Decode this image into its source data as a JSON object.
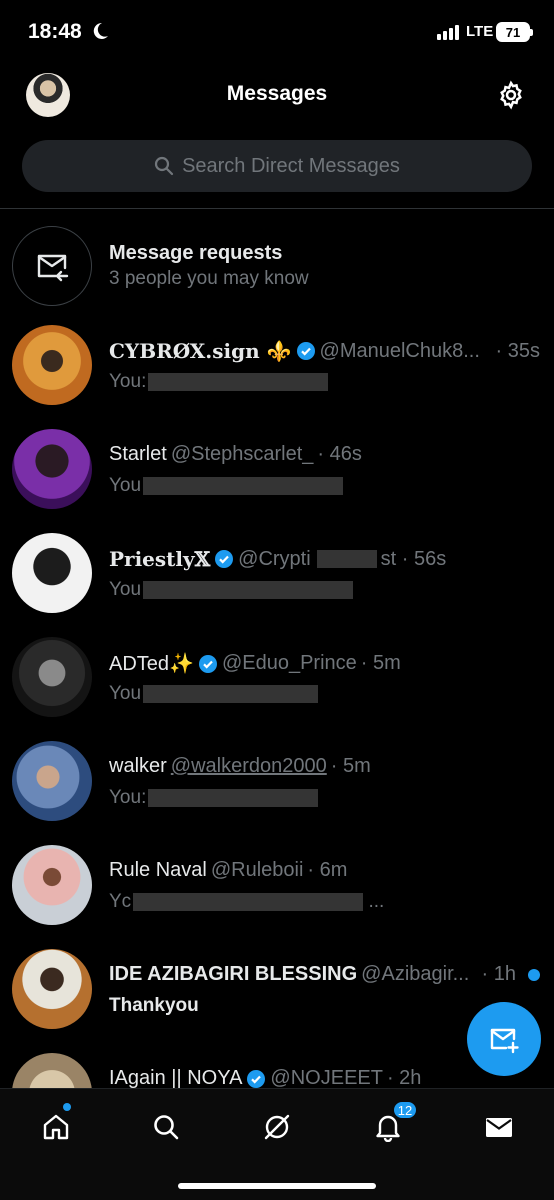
{
  "status_bar": {
    "time": "18:48",
    "network": "LTE",
    "battery": "71"
  },
  "header": {
    "title": "Messages"
  },
  "search": {
    "placeholder": "Search Direct Messages"
  },
  "message_requests": {
    "title": "Message requests",
    "subtitle": "3 people you may know"
  },
  "conversations": [
    {
      "name": "CYBRØX.sign ⚜️",
      "handle": "@ManuelChuk8...",
      "time": "· 35s",
      "preview": "You:",
      "verified": true
    },
    {
      "name": "Starlet",
      "handle": "@Stephscarlet_",
      "time": "· 46s",
      "preview": "You",
      "verified": false
    },
    {
      "name": "Priestly𝕏",
      "handle": "@Crypti",
      "time": "st · 56s",
      "preview": "You",
      "verified": true
    },
    {
      "name": "ADTed✨",
      "handle": "@Eduo_Prince",
      "time": "· 5m",
      "preview": "You",
      "verified": true
    },
    {
      "name": "walker",
      "handle": "@walkerdon2000",
      "time": "· 5m",
      "preview": "You:",
      "verified": false
    },
    {
      "name": "Rule Naval",
      "handle": "@Ruleboii",
      "time": "· 6m",
      "preview": "Yc",
      "preview_end": "...",
      "verified": false
    },
    {
      "name": "IDE AZIBAGIRI BLESSING",
      "handle": "@Azibagir...",
      "time": "· 1h",
      "preview": "Thankyou",
      "verified": false,
      "unread": true
    },
    {
      "name": "IAgain || NOYA",
      "handle": "@NOJEEET",
      "time": "· 2h",
      "verified": true
    }
  ],
  "tabbar": {
    "notification_count": "12"
  },
  "colors": {
    "accent": "#1d9bf0",
    "background": "#000000",
    "muted": "#71767b"
  }
}
